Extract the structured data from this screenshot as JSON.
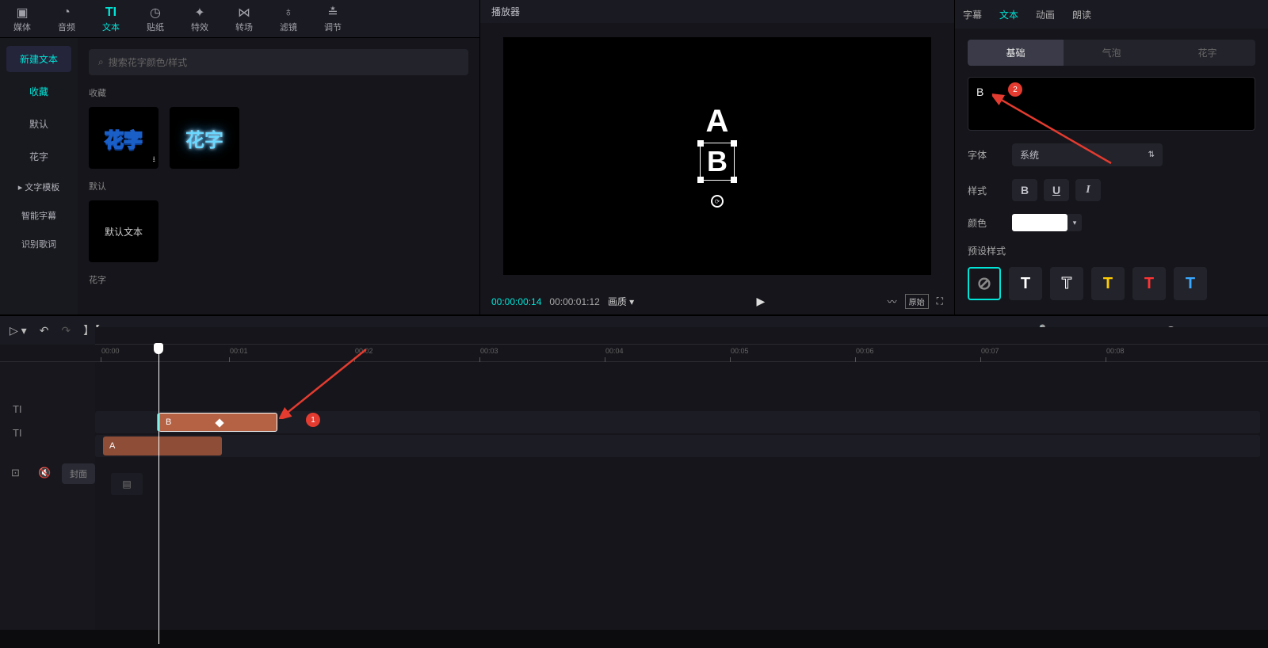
{
  "toolbar": [
    {
      "label": "媒体",
      "icon": "▣"
    },
    {
      "label": "音频",
      "icon": "◔"
    },
    {
      "label": "文本",
      "icon": "TI",
      "active": true
    },
    {
      "label": "贴纸",
      "icon": "◷"
    },
    {
      "label": "特效",
      "icon": "✦"
    },
    {
      "label": "转场",
      "icon": "⋈"
    },
    {
      "label": "滤镜",
      "icon": "♁"
    },
    {
      "label": "调节",
      "icon": "≛"
    }
  ],
  "sidebar": {
    "items": [
      {
        "label": "新建文本",
        "kind": "primary"
      },
      {
        "label": "收藏",
        "kind": "active"
      },
      {
        "label": "默认",
        "kind": ""
      },
      {
        "label": "花字",
        "kind": ""
      },
      {
        "label": "▸ 文字模板",
        "kind": "sub"
      },
      {
        "label": "智能字幕",
        "kind": "sub"
      },
      {
        "label": "识别歌词",
        "kind": "sub"
      }
    ]
  },
  "browser": {
    "search_placeholder": "搜索花字颜色/样式",
    "section_fav": "收藏",
    "section_def": "默认",
    "section_flower": "花字",
    "thumb1": "花字",
    "thumb2": "花字",
    "thumb_def": "默认文本"
  },
  "player": {
    "title": "播放器",
    "text_a": "A",
    "text_b": "B",
    "time_cur": "00:00:00:14",
    "time_dur": "00:00:01:12",
    "quality": "画质",
    "btn_ratio": "原始"
  },
  "inspector": {
    "tabs": [
      {
        "label": "字幕"
      },
      {
        "label": "文本",
        "active": true
      },
      {
        "label": "动画"
      },
      {
        "label": "朗读"
      }
    ],
    "subtabs": [
      {
        "label": "基础",
        "active": true
      },
      {
        "label": "气泡"
      },
      {
        "label": "花字"
      }
    ],
    "text_value": "B",
    "font_label": "字体",
    "font_value": "系统",
    "style_label": "样式",
    "color_label": "颜色",
    "preset_label": "预设样式",
    "preset_letter": "T"
  },
  "timeline": {
    "ticks": [
      "00:00",
      "00:01",
      "00:02",
      "00:03",
      "00:04",
      "00:05",
      "00:06",
      "00:07",
      "00:08"
    ],
    "clip_b": "B",
    "clip_a": "A",
    "cover": "封面"
  },
  "annotations": {
    "badge1": "1",
    "badge2": "2"
  }
}
